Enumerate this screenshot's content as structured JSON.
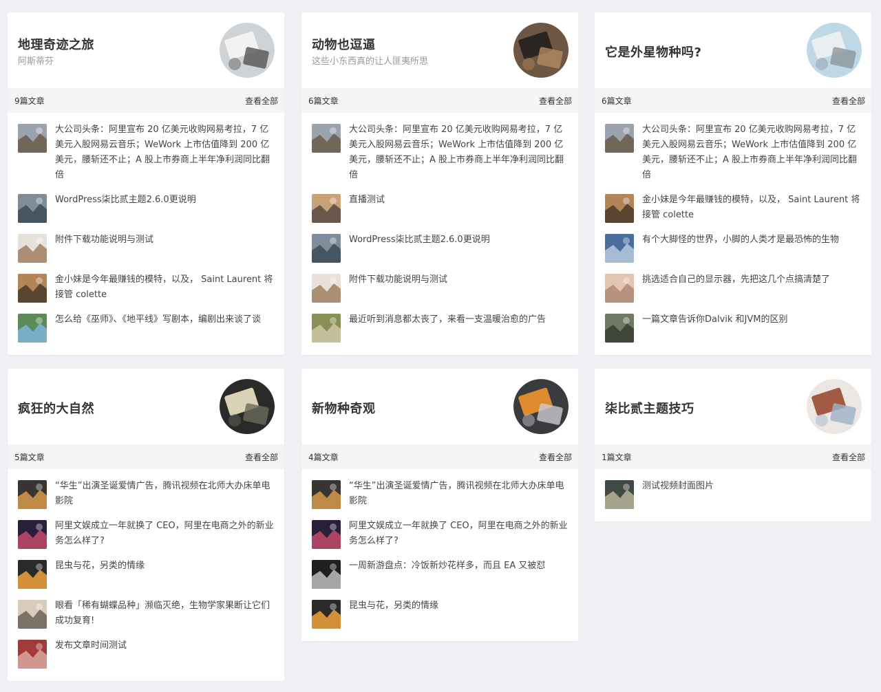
{
  "cards": [
    {
      "title": "地理奇迹之旅",
      "subtitle": "阿斯蒂芬",
      "count": "9篇文章",
      "view_all": "查看全部",
      "cover": [
        "#cfd3d6",
        "#f2f2f2",
        "#555"
      ],
      "items": [
        {
          "text": "大公司头条：阿里宣布 20 亿美元收购网易考拉，7 亿美元入股网易云音乐；WeWork 上市估值降到 200 亿美元，腰斩还不止；A 股上市券商上半年净利润同比翻倍",
          "c": [
            "#9aa3ac",
            "#6b5a4a"
          ]
        },
        {
          "text": "WordPress柒比贰主题2.6.0更说明",
          "c": [
            "#7f8c99",
            "#3d4b59"
          ]
        },
        {
          "text": "附件下载功能说明与测试",
          "c": [
            "#e7e1d9",
            "#a07f62"
          ]
        },
        {
          "text": "金小妹是今年最赚钱的模特，以及， Saint Laurent 将接管 colette",
          "c": [
            "#b38455",
            "#4a3a2c"
          ]
        },
        {
          "text": "怎么给《巫师》、《地平线》写剧本，编剧出来谈了谈",
          "c": [
            "#5d8a5a",
            "#7fb3d9"
          ]
        }
      ]
    },
    {
      "title": "动物也逗逼",
      "subtitle": "这些小东西真的让人匪夷所思",
      "count": "6篇文章",
      "view_all": "查看全部",
      "cover": [
        "#6e5643",
        "#2b2521",
        "#b18a5f"
      ],
      "items": [
        {
          "text": "大公司头条：阿里宣布 20 亿美元收购网易考拉，7 亿美元入股网易云音乐；WeWork 上市估值降到 200 亿美元，腰斩还不止；A 股上市券商上半年净利润同比翻倍",
          "c": [
            "#9aa3ac",
            "#6b5a4a"
          ]
        },
        {
          "text": "直播测试",
          "c": [
            "#c9a27a",
            "#5a4b45"
          ]
        },
        {
          "text": "WordPress柒比贰主题2.6.0更说明",
          "c": [
            "#7f8c99",
            "#3d4b59"
          ]
        },
        {
          "text": "附件下载功能说明与测试",
          "c": [
            "#e7e1d9",
            "#a07f62"
          ]
        },
        {
          "text": "最近听到消息都太丧了，来看一支温暖治愈的广告",
          "c": [
            "#8a8f55",
            "#cfc7a8"
          ]
        }
      ]
    },
    {
      "title": "它是外星物种吗?",
      "subtitle": "",
      "count": "6篇文章",
      "view_all": "查看全部",
      "cover": [
        "#bfd8e6",
        "#e9eef1",
        "#8d969c"
      ],
      "items": [
        {
          "text": "大公司头条：阿里宣布 20 亿美元收购网易考拉，7 亿美元入股网易云音乐；WeWork 上市估值降到 200 亿美元，腰斩还不止；A 股上市券商上半年净利润同比翻倍",
          "c": [
            "#9aa3ac",
            "#6b5a4a"
          ]
        },
        {
          "text": "金小妹是今年最赚钱的模特，以及， Saint Laurent 将接管 colette",
          "c": [
            "#b38455",
            "#4a3a2c"
          ]
        },
        {
          "text": "有个大脚怪的世界，小脚的人类才是最恐怖的生物",
          "c": [
            "#4b6f9c",
            "#b9c9de"
          ]
        },
        {
          "text": "挑选适合自己的显示器，先把这几个点搞清楚了",
          "c": [
            "#e2c4b0",
            "#b08a76"
          ]
        },
        {
          "text": "一篇文章告诉你Dalvik 和JVM的区别",
          "c": [
            "#6f7a64",
            "#3a3d33"
          ]
        }
      ]
    },
    {
      "title": "疯狂的大自然",
      "subtitle": "",
      "count": "5篇文章",
      "view_all": "查看全部",
      "cover": [
        "#2a2a2a",
        "#d9d2b6",
        "#6b6a5e"
      ],
      "items": [
        {
          "text": "“华生”出演圣诞爱情广告，腾讯视频在北师大办床单电影院",
          "c": [
            "#3a3430",
            "#d79a4a"
          ]
        },
        {
          "text": "阿里文娱成立一年就换了 CEO，阿里在电商之外的新业务怎么样了?",
          "c": [
            "#2a1f3a",
            "#c24a6a"
          ]
        },
        {
          "text": "昆虫与花，另类的情缘",
          "c": [
            "#2a2a2a",
            "#f1a23a"
          ]
        },
        {
          "text": "眼看「稀有蝴蝶品种」濒临灭绝，生物学家果断让它们成功复育!",
          "c": [
            "#d9ccbd",
            "#6b6058"
          ]
        },
        {
          "text": "发布文章时间测试",
          "c": [
            "#a23a3a",
            "#d9a7a0"
          ]
        }
      ]
    },
    {
      "title": "新物种奇观",
      "subtitle": "",
      "count": "4篇文章",
      "view_all": "查看全部",
      "cover": [
        "#3a3b3e",
        "#e08a2e",
        "#c9ccd0"
      ],
      "items": [
        {
          "text": "“华生”出演圣诞爱情广告，腾讯视频在北师大办床单电影院",
          "c": [
            "#3a3430",
            "#d79a4a"
          ]
        },
        {
          "text": "阿里文娱成立一年就换了 CEO，阿里在电商之外的新业务怎么样了?",
          "c": [
            "#2a1f3a",
            "#c24a6a"
          ]
        },
        {
          "text": "一周新游盘点：冷饭新炒花样多，而且 EA 又被怼",
          "c": [
            "#1f1f1f",
            "#bdbdbd"
          ]
        },
        {
          "text": "昆虫与花，另类的情缘",
          "c": [
            "#2a2a2a",
            "#f1a23a"
          ]
        }
      ]
    },
    {
      "title": "柒比贰主题技巧",
      "subtitle": "",
      "count": "1篇文章",
      "view_all": "查看全部",
      "cover": [
        "#ece7e3",
        "#a35a45",
        "#9fb3c8"
      ],
      "items": [
        {
          "text": "测试视频封面图片",
          "c": [
            "#3f4a44",
            "#b9b39a"
          ]
        }
      ]
    }
  ]
}
